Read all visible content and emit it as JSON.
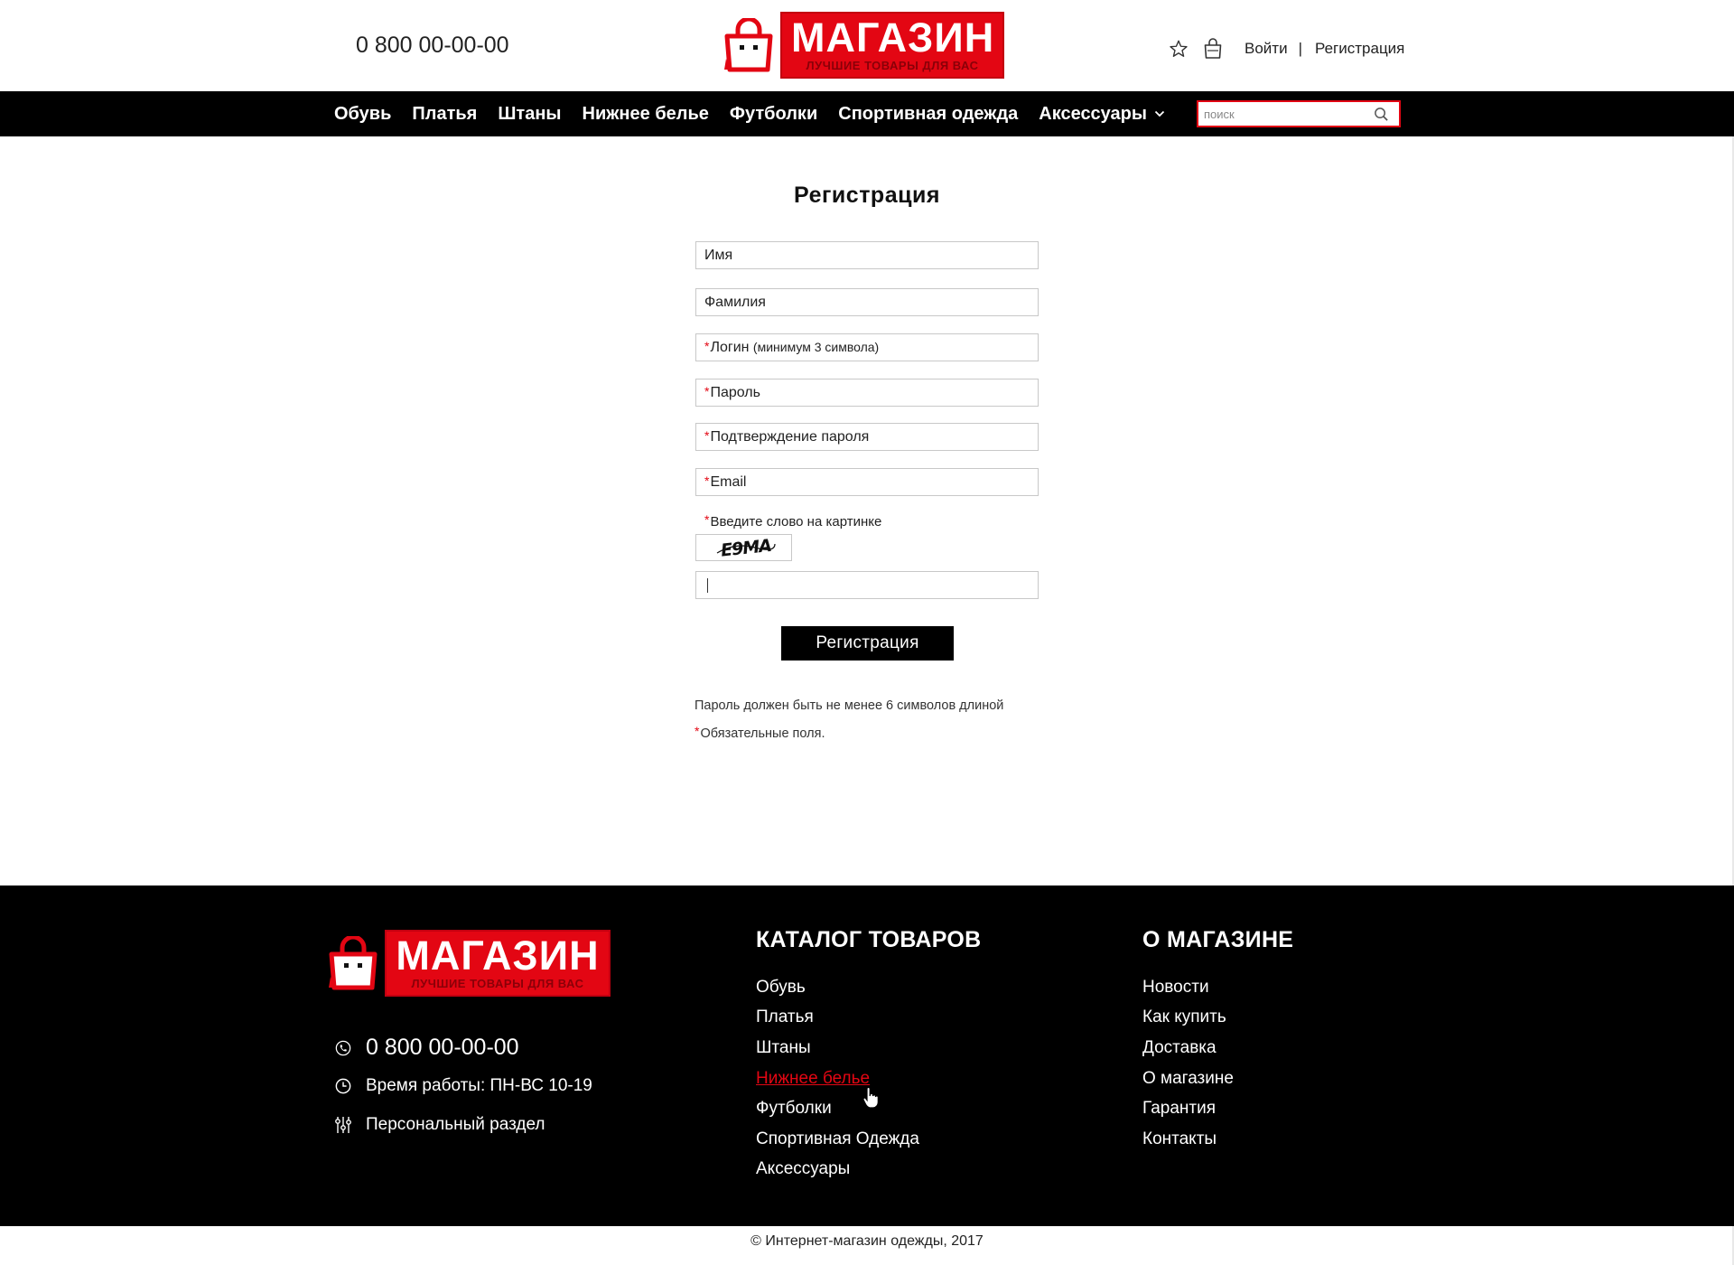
{
  "header": {
    "phone": "0 800 00-00-00",
    "logo_title": "МАГАЗИН",
    "logo_subtitle": "ЛУЧШИЕ ТОВАРЫ ДЛЯ ВАС",
    "favorites_icon": "star-icon",
    "cart_icon": "shopping-bag-icon",
    "login_label": "Войти",
    "separator": "|",
    "register_label": "Регистрация"
  },
  "nav": {
    "items": [
      "Обувь",
      "Платья",
      "Штаны",
      "Нижнее белье",
      "Футболки",
      "Спортивная одежда",
      "Аксессуары"
    ],
    "dropdown_icon": "chevron-down-icon",
    "search_placeholder": "поиск",
    "search_icon": "search-icon"
  },
  "form": {
    "title": "Регистрация",
    "fields": {
      "first_name": "Имя",
      "last_name": "Фамилия",
      "login_required_mark": "*",
      "login": "Логин",
      "login_hint": "(минимум 3 символа)",
      "password": "Пароль",
      "password_confirm": "Подтверждение пароля",
      "email": "Email"
    },
    "required_mark": "*",
    "captcha_label": "Введите слово на картинке",
    "captcha_text": "E9MA",
    "captcha_value": "",
    "submit_label": "Регистрация",
    "password_note": "Пароль должен быть не менее 6 символов длиной",
    "required_note": "Обязательные поля."
  },
  "footer": {
    "logo_title": "МАГАЗИН",
    "logo_subtitle": "ЛУЧШИЕ ТОВАРЫ ДЛЯ ВАС",
    "phone": "0 800 00-00-00",
    "hours": "Время работы: ПН-ВС 10-19",
    "personal": "Персональный раздел",
    "catalog_title": "КАТАЛОГ ТОВАРОВ",
    "catalog_links": [
      "Обувь",
      "Платья",
      "Штаны",
      "Нижнее белье",
      "Футболки",
      "Спортивная Одежда",
      "Аксессуары"
    ],
    "about_title": "О МАГАЗИНЕ",
    "about_links": [
      "Новости",
      "Как купить",
      "Доставка",
      "О магазине",
      "Гарантия",
      "Контакты"
    ],
    "active_catalog_link": "Нижнее белье"
  },
  "copyright": "© Интернет-магазин одежды, 2017",
  "colors": {
    "brand_red": "#e30613",
    "nav_bg": "#000000",
    "footer_bg": "#000000"
  }
}
